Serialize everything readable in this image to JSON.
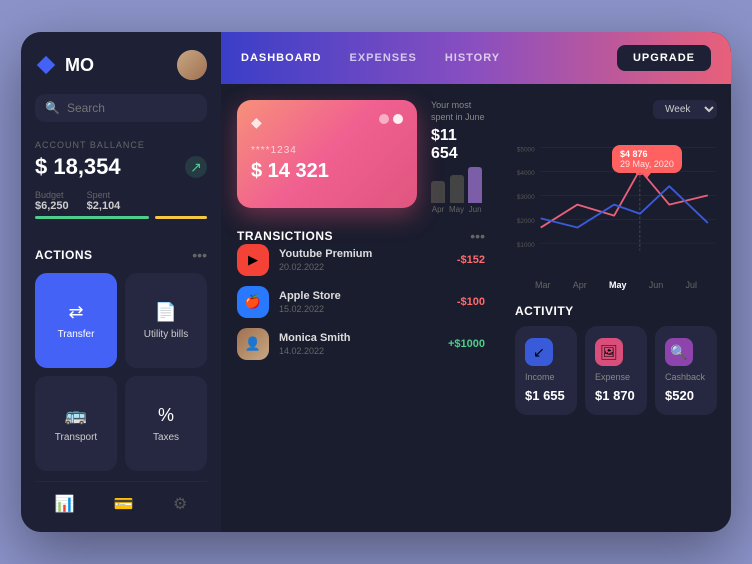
{
  "app": {
    "title": "MO",
    "upgrade_label": "UPGRADE"
  },
  "nav": {
    "links": [
      "DASHBOARD",
      "EXPENSES",
      "HISTORY"
    ],
    "active": "DASHBOARD"
  },
  "sidebar": {
    "search_placeholder": "Search",
    "account_label": "ACCOUNT BALLANCE",
    "account_balance": "$ 18,354",
    "budget_label": "Budget",
    "budget_value": "$6,250",
    "spent_label": "Spent",
    "spent_value": "$2,104",
    "actions_title": "ACTIONS",
    "actions": [
      {
        "label": "Transfer",
        "icon": "⇄",
        "active": true
      },
      {
        "label": "Utility bills",
        "icon": "🧾",
        "active": false
      },
      {
        "label": "Transport",
        "icon": "🚌",
        "active": false
      },
      {
        "label": "Taxes",
        "icon": "%",
        "active": false
      }
    ]
  },
  "card": {
    "number": "****1234",
    "balance": "$ 14 321",
    "most_spent_label": "Your most spent in June",
    "most_spent_value": "$11 654",
    "months": [
      "Apr",
      "May",
      "Jun"
    ]
  },
  "transactions": {
    "title": "TRANSICTIONS",
    "items": [
      {
        "name": "Youtube Premium",
        "date": "20.02.2022",
        "amount": "-$152",
        "type": "neg",
        "icon": "▶"
      },
      {
        "name": "Apple Store",
        "date": "15.02.2022",
        "amount": "-$100",
        "type": "neg",
        "icon": "🍎"
      },
      {
        "name": "Monica Smith",
        "date": "14.02.2022",
        "amount": "+$1000",
        "type": "pos",
        "icon": "👤"
      }
    ]
  },
  "chart": {
    "title": "ACTIVITY",
    "week_label": "Week",
    "tooltip_value": "$4 876",
    "tooltip_date": "29 May, 2020",
    "y_labels": [
      "$5000",
      "$4000",
      "$3000",
      "$2000",
      "$1000"
    ],
    "x_labels": [
      "Mar",
      "Apr",
      "May",
      "Jun",
      "Jul"
    ],
    "active_x": "May"
  },
  "activity": {
    "title": "ACTIVITY",
    "items": [
      {
        "label": "Income",
        "value": "$1 655",
        "icon": "↙",
        "color": "blue"
      },
      {
        "label": "Expense",
        "value": "$1 870",
        "icon": "🖼",
        "color": "pink"
      },
      {
        "label": "Cashback",
        "value": "$520",
        "icon": "🔍",
        "color": "purple"
      }
    ]
  }
}
